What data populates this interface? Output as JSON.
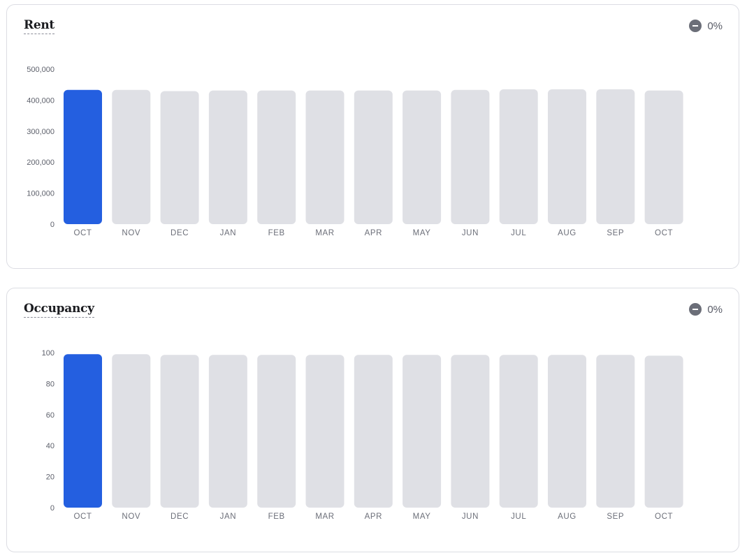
{
  "colors": {
    "highlight_bar": "#245fe0",
    "default_bar": "#dfe0e5",
    "tick_text": "#5d606b"
  },
  "cards": [
    {
      "title": "Rent",
      "change": "0%",
      "change_icon": "minus-circle-icon",
      "chart_data": {
        "type": "bar",
        "categories": [
          "OCT",
          "NOV",
          "DEC",
          "JAN",
          "FEB",
          "MAR",
          "APR",
          "MAY",
          "JUN",
          "JUL",
          "AUG",
          "SEP",
          "OCT"
        ],
        "values": [
          433000,
          433000,
          429000,
          431000,
          431000,
          431000,
          431000,
          431000,
          433000,
          435000,
          435000,
          435000,
          431000
        ],
        "highlight_index": 0,
        "ylim": [
          0,
          500000
        ],
        "yticks": [
          {
            "value": 0,
            "label": "0"
          },
          {
            "value": 100000,
            "label": "100,000"
          },
          {
            "value": 200000,
            "label": "200,000"
          },
          {
            "value": 300000,
            "label": "300,000"
          },
          {
            "value": 400000,
            "label": "400,000"
          },
          {
            "value": 500000,
            "label": "500,000"
          }
        ],
        "grid": false,
        "legend": "none"
      }
    },
    {
      "title": "Occupancy",
      "change": "0%",
      "change_icon": "minus-circle-icon",
      "chart_data": {
        "type": "bar",
        "categories": [
          "OCT",
          "NOV",
          "DEC",
          "JAN",
          "FEB",
          "MAR",
          "APR",
          "MAY",
          "JUN",
          "JUL",
          "AUG",
          "SEP",
          "OCT"
        ],
        "values": [
          99,
          99,
          98.5,
          98.5,
          98.5,
          98.5,
          98.5,
          98.5,
          98.5,
          98.5,
          98.5,
          98.5,
          98
        ],
        "highlight_index": 0,
        "ylim": [
          0,
          100
        ],
        "yticks": [
          {
            "value": 0,
            "label": "0"
          },
          {
            "value": 20,
            "label": "20"
          },
          {
            "value": 40,
            "label": "40"
          },
          {
            "value": 60,
            "label": "60"
          },
          {
            "value": 80,
            "label": "80"
          },
          {
            "value": 100,
            "label": "100"
          }
        ],
        "grid": false,
        "legend": "none"
      }
    }
  ]
}
